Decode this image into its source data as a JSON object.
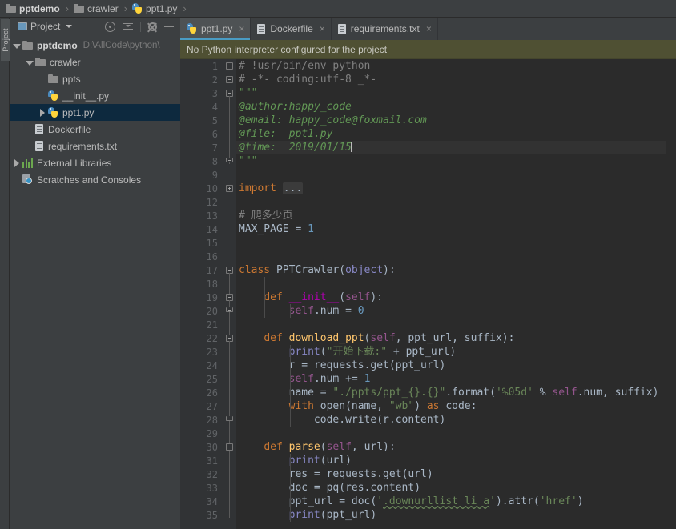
{
  "window": {
    "theme": "darcula",
    "colors": {
      "bg_panel": "#3c3f41",
      "bg_editor": "#2b2b2b",
      "bg_gutter": "#313335",
      "accent_tab": "#4a9cc4",
      "selection": "#0d293e",
      "notification_bg": "#4f5033",
      "comment": "#808080",
      "string": "#6a8759",
      "docstring": "#629755",
      "keyword": "#cc7832",
      "function": "#ffc66d",
      "number": "#6897bb",
      "self": "#94558d",
      "builtin": "#8888c6"
    }
  },
  "breadcrumb": {
    "items": [
      {
        "label": "pptdemo",
        "icon": "folder-icon",
        "bold": true
      },
      {
        "label": "crawler",
        "icon": "folder-icon",
        "bold": false
      },
      {
        "label": "ppt1.py",
        "icon": "python-file-icon",
        "bold": false
      }
    ],
    "separator": "›"
  },
  "sidebar": {
    "vertical_tab": "Project",
    "title": "Project",
    "dropdown_caret": "▾",
    "tools": [
      {
        "name": "locate-icon",
        "title": "Select Opened File"
      },
      {
        "name": "collapse-all-icon",
        "title": "Collapse All"
      },
      {
        "name": "gear-icon",
        "title": "Settings"
      },
      {
        "name": "minimize-icon",
        "title": "Hide"
      }
    ],
    "tree": [
      {
        "label": "pptdemo",
        "path": "D:\\AllCode\\python\\",
        "icon": "folder-icon",
        "indent": 0,
        "arrow": "down",
        "bold": true,
        "selected": false
      },
      {
        "label": "crawler",
        "path": "",
        "icon": "folder-icon",
        "indent": 1,
        "arrow": "down",
        "bold": false,
        "selected": false
      },
      {
        "label": "ppts",
        "path": "",
        "icon": "folder-icon",
        "indent": 2,
        "arrow": "none",
        "bold": false,
        "selected": false
      },
      {
        "label": "__init__.py",
        "path": "",
        "icon": "python-file-icon",
        "indent": 2,
        "arrow": "none",
        "bold": false,
        "selected": false
      },
      {
        "label": "ppt1.py",
        "path": "",
        "icon": "python-file-icon",
        "indent": 2,
        "arrow": "right",
        "bold": false,
        "selected": true
      },
      {
        "label": "Dockerfile",
        "path": "",
        "icon": "text-file-icon",
        "indent": 1,
        "arrow": "none",
        "bold": false,
        "selected": false
      },
      {
        "label": "requirements.txt",
        "path": "",
        "icon": "text-file-icon",
        "indent": 1,
        "arrow": "none",
        "bold": false,
        "selected": false
      },
      {
        "label": "External Libraries",
        "path": "",
        "icon": "library-icon",
        "indent": 0,
        "arrow": "right",
        "bold": false,
        "selected": false
      },
      {
        "label": "Scratches and Consoles",
        "path": "",
        "icon": "scratches-icon",
        "indent": 0,
        "arrow": "none",
        "bold": false,
        "selected": false
      }
    ]
  },
  "editor": {
    "tabs": [
      {
        "label": "ppt1.py",
        "icon": "python-file-icon",
        "active": true,
        "close": "×"
      },
      {
        "label": "Dockerfile",
        "icon": "text-file-icon",
        "active": false,
        "close": "×"
      },
      {
        "label": "requirements.txt",
        "icon": "text-file-icon",
        "active": false,
        "close": "×"
      }
    ],
    "notification": "No Python interpreter configured for the project",
    "current_line": 7,
    "line_numbers": [
      1,
      2,
      3,
      4,
      5,
      6,
      7,
      8,
      9,
      10,
      12,
      13,
      14,
      15,
      16,
      17,
      18,
      19,
      20,
      21,
      22,
      23,
      24,
      25,
      26,
      27,
      28,
      29,
      30,
      31,
      32,
      33,
      34,
      35
    ],
    "code_lines": [
      "# !usr/bin/env python",
      "# -*- coding:utf-8 _*-",
      "\"\"\"",
      "@author:happy_code",
      "@email: happy_code@foxmail.com",
      "@file:  ppt1.py",
      "@time:  2019/01/15",
      "\"\"\"",
      "",
      "import ...",
      "",
      "# 爬多少页",
      "MAX_PAGE = 1",
      "",
      "",
      "class PPTCrawler(object):",
      "",
      "    def __init__(self):",
      "        self.num = 0",
      "",
      "    def download_ppt(self, ppt_url, suffix):",
      "        print(\"开始下载:\" + ppt_url)",
      "        r = requests.get(ppt_url)",
      "        self.num += 1",
      "        name = \"./ppts/ppt_{}.{}\".format('%05d' % self.num, suffix)",
      "        with open(name, \"wb\") as code:",
      "            code.write(r.content)",
      "",
      "    def parse(self, url):",
      "        print(url)",
      "        res = requests.get(url)",
      "        doc = pq(res.content)",
      "        ppt_url = doc('.downurllist li a').attr('href')",
      "        print(ppt_url)"
    ]
  }
}
